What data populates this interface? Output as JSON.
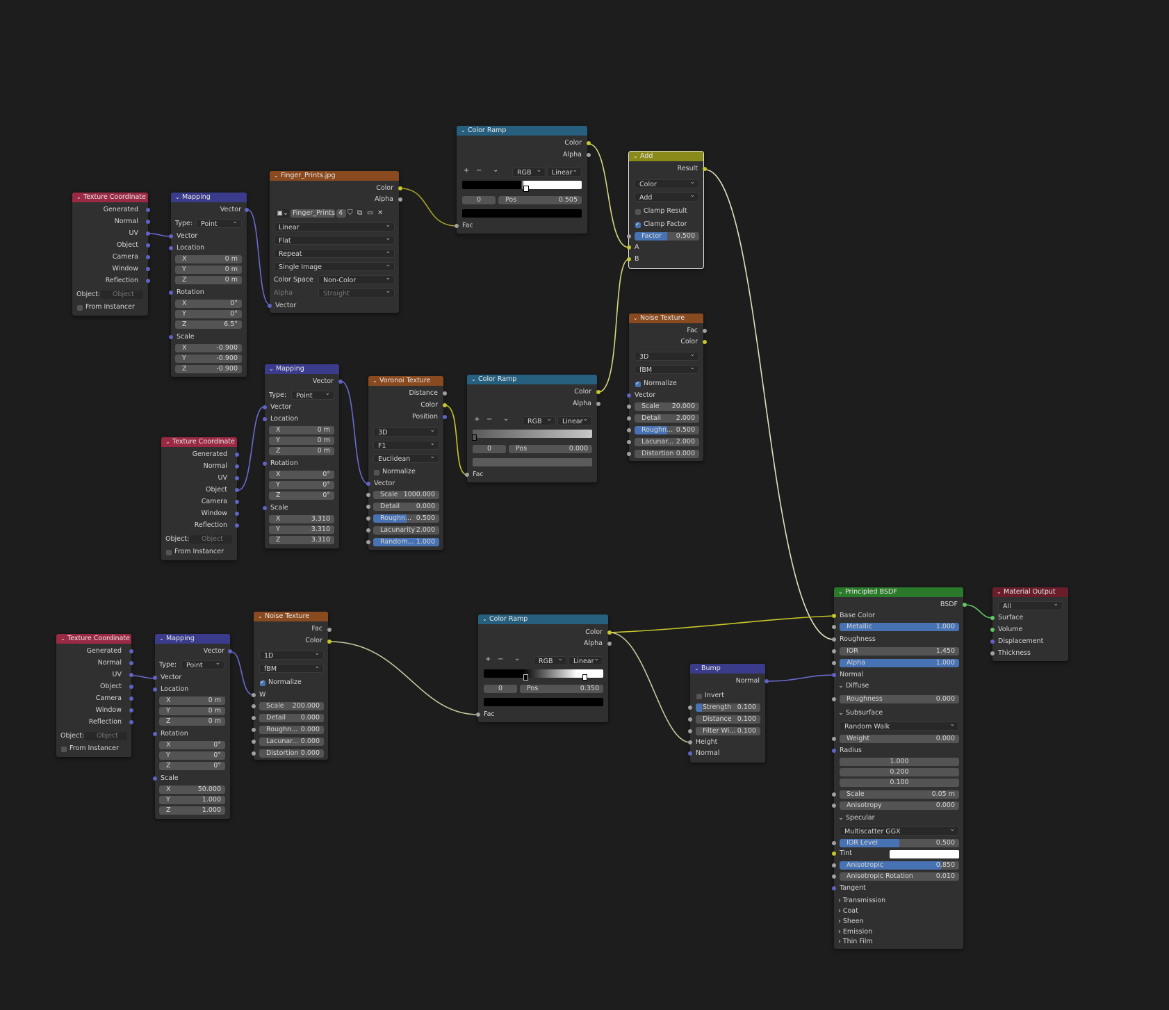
{
  "nodes": {
    "tc1": {
      "title": "Texture Coordinate",
      "outputs": [
        "Generated",
        "Normal",
        "UV",
        "Object",
        "Camera",
        "Window",
        "Reflection"
      ],
      "object_label": "Object:",
      "object_placeholder": "Object",
      "from_instancer": "From Instancer"
    },
    "map1": {
      "title": "Mapping",
      "output": "Vector",
      "type_label": "Type:",
      "type_value": "Point",
      "vector_in": "Vector",
      "location": "Location",
      "loc": {
        "x": "0 m",
        "y": "0 m",
        "z": "0 m"
      },
      "rotation": "Rotation",
      "rot": {
        "x": "0°",
        "y": "0°",
        "z": "6.5°"
      },
      "scale": "Scale",
      "scl": {
        "x": "-0.900",
        "y": "-0.900",
        "z": "-0.900"
      }
    },
    "img": {
      "title": "Finger_Prints.jpg",
      "out_color": "Color",
      "out_alpha": "Alpha",
      "image_name": "Finger_Prints...",
      "users": "4",
      "interp": "Linear",
      "proj": "Flat",
      "ext": "Repeat",
      "source": "Single Image",
      "cs_label": "Color Space",
      "cs_value": "Non-Color",
      "alpha_label": "Alpha",
      "alpha_value": "Straight",
      "vector_in": "Vector"
    },
    "cr1": {
      "title": "Color Ramp",
      "out_color": "Color",
      "out_alpha": "Alpha",
      "mode": "RGB",
      "interp": "Linear",
      "index": "0",
      "pos_label": "Pos",
      "pos_value": "0.505",
      "fac": "Fac"
    },
    "add": {
      "title": "Add",
      "result": "Result",
      "dtype": "Color",
      "op": "Add",
      "clamp_result": "Clamp Result",
      "clamp_factor": "Clamp Factor",
      "factor_label": "Factor",
      "factor_value": "0.500",
      "a": "A",
      "b": "B"
    },
    "map2": {
      "title": "Mapping",
      "output": "Vector",
      "type_label": "Type:",
      "type_value": "Point",
      "vector_in": "Vector",
      "location": "Location",
      "loc": {
        "x": "0 m",
        "y": "0 m",
        "z": "0 m"
      },
      "rotation": "Rotation",
      "rot": {
        "x": "0°",
        "y": "0°",
        "z": "0°"
      },
      "scale": "Scale",
      "scl": {
        "x": "3.310",
        "y": "3.310",
        "z": "3.310"
      }
    },
    "tc2": {
      "title": "Texture Coordinate",
      "outputs": [
        "Generated",
        "Normal",
        "UV",
        "Object",
        "Camera",
        "Window",
        "Reflection"
      ],
      "object_label": "Object:",
      "object_placeholder": "Object",
      "from_instancer": "From Instancer"
    },
    "vor": {
      "title": "Voronoi Texture",
      "outputs": [
        "Distance",
        "Color",
        "Position"
      ],
      "dims": "3D",
      "feature": "F1",
      "metric": "Euclidean",
      "normalize": "Normalize",
      "vector_in": "Vector",
      "fields": [
        {
          "label": "Scale",
          "value": "1000.000"
        },
        {
          "label": "Detail",
          "value": "0.000"
        },
        {
          "label": "Roughn...",
          "value": "0.500"
        },
        {
          "label": "Lacunarity",
          "value": "2.000"
        },
        {
          "label": "Random...",
          "value": "1.000"
        }
      ]
    },
    "cr2": {
      "title": "Color Ramp",
      "out_color": "Color",
      "out_alpha": "Alpha",
      "mode": "RGB",
      "interp": "Linear",
      "index": "0",
      "pos_label": "Pos",
      "pos_value": "0.000",
      "fac": "Fac"
    },
    "noise1": {
      "title": "Noise Texture",
      "outputs": [
        "Fac",
        "Color"
      ],
      "dims": "3D",
      "type": "fBM",
      "normalize": "Normalize",
      "vector_in": "Vector",
      "fields": [
        {
          "label": "Scale",
          "value": "20.000"
        },
        {
          "label": "Detail",
          "value": "2.000"
        },
        {
          "label": "Roughn...",
          "value": "0.500"
        },
        {
          "label": "Lacunar...",
          "value": "2.000"
        },
        {
          "label": "Distortion",
          "value": "0.000"
        }
      ]
    },
    "tc3": {
      "title": "Texture Coordinate",
      "outputs": [
        "Generated",
        "Normal",
        "UV",
        "Object",
        "Camera",
        "Window",
        "Reflection"
      ],
      "object_label": "Object:",
      "object_placeholder": "Object",
      "from_instancer": "From Instancer"
    },
    "map3": {
      "title": "Mapping",
      "output": "Vector",
      "type_label": "Type:",
      "type_value": "Point",
      "vector_in": "Vector",
      "location": "Location",
      "loc": {
        "x": "0 m",
        "y": "0 m",
        "z": "0 m"
      },
      "rotation": "Rotation",
      "rot": {
        "x": "0°",
        "y": "0°",
        "z": "0°"
      },
      "scale": "Scale",
      "scl": {
        "x": "50.000",
        "y": "1.000",
        "z": "1.000"
      }
    },
    "noise2": {
      "title": "Noise Texture",
      "outputs": [
        "Fac",
        "Color"
      ],
      "dims": "1D",
      "type": "fBM",
      "normalize": "Normalize",
      "w_in": "W",
      "fields": [
        {
          "label": "Scale",
          "value": "200.000"
        },
        {
          "label": "Detail",
          "value": "0.000"
        },
        {
          "label": "Roughn...",
          "value": "0.000"
        },
        {
          "label": "Lacunar...",
          "value": "0.000"
        },
        {
          "label": "Distortion",
          "value": "0.000"
        }
      ]
    },
    "cr3": {
      "title": "Color Ramp",
      "out_color": "Color",
      "out_alpha": "Alpha",
      "mode": "RGB",
      "interp": "Linear",
      "index": "0",
      "pos_label": "Pos",
      "pos_value": "0.350",
      "fac": "Fac"
    },
    "bump": {
      "title": "Bump",
      "output": "Normal",
      "invert": "Invert",
      "fields": [
        {
          "label": "Strength",
          "value": "0.100"
        },
        {
          "label": "Distance",
          "value": "0.100"
        },
        {
          "label": "Filter Wi...",
          "value": "0.100"
        }
      ],
      "height": "Height",
      "normal_in": "Normal"
    },
    "bsdf": {
      "title": "Principled BSDF",
      "output": "BSDF",
      "base_color": "Base Color",
      "metallic_label": "Metallic",
      "metallic_value": "1.000",
      "roughness": "Roughness",
      "ior_label": "IOR",
      "ior_value": "1.450",
      "alpha_label": "Alpha",
      "alpha_value": "1.000",
      "normal": "Normal",
      "diffuse": "Diffuse",
      "diffuse_rough_label": "Roughness",
      "diffuse_rough_value": "0.000",
      "subsurface": "Subsurface",
      "ss_method": "Random Walk",
      "weight_label": "Weight",
      "weight_value": "0.000",
      "radius": "Radius",
      "radius_values": [
        "1.000",
        "0.200",
        "0.100"
      ],
      "ss_scale_label": "Scale",
      "ss_scale_value": "0.05 m",
      "ss_aniso_label": "Anisotropy",
      "ss_aniso_value": "0.000",
      "specular": "Specular",
      "spec_dist": "Multiscatter GGX",
      "ior_level_label": "IOR Level",
      "ior_level_value": "0.500",
      "tint": "Tint",
      "aniso_label": "Anisotropic",
      "aniso_value": "0.850",
      "aniso_rot_label": "Anisotropic Rotation",
      "aniso_rot_value": "0.010",
      "tangent": "Tangent",
      "panels": [
        "Transmission",
        "Coat",
        "Sheen",
        "Emission",
        "Thin Film"
      ]
    },
    "out": {
      "title": "Material Output",
      "target": "All",
      "inputs": [
        "Surface",
        "Volume",
        "Displacement",
        "Thickness"
      ]
    }
  },
  "colors": {
    "vector_socket": "#6363c7",
    "color_socket": "#c7c729",
    "float_socket": "#a1a1a1",
    "shader_socket": "#63c763",
    "accent": "#4772b3",
    "background": "#1d1d1d"
  }
}
